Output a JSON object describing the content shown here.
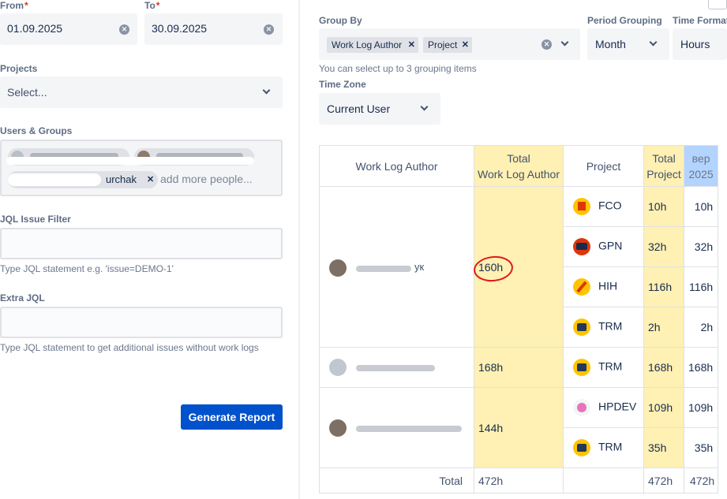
{
  "filters": {
    "from_label": "From",
    "from_value": "01.09.2025",
    "to_label": "To",
    "to_value": "30.09.2025",
    "projects_label": "Projects",
    "projects_placeholder": "Select...",
    "users_label": "Users & Groups",
    "users_chip_3_suffix": "urchak",
    "users_add_more": "add more people...",
    "jql_label": "JQL Issue Filter",
    "jql_hint": "Type JQL statement e.g. 'issue=DEMO-1'",
    "extra_jql_label": "Extra JQL",
    "extra_jql_hint": "Type JQL statement to get additional issues without work logs",
    "generate_label": "Generate Report"
  },
  "grouping": {
    "group_by_label": "Group By",
    "tags": [
      "Work Log Author",
      "Project"
    ],
    "group_hint": "You can select up to 3 grouping items",
    "period_label": "Period Grouping",
    "period_value": "Month",
    "time_format_label": "Time Format",
    "time_format_value": "Hours",
    "timezone_label": "Time Zone",
    "timezone_value": "Current User"
  },
  "table": {
    "headers": {
      "author": "Work Log Author",
      "total_author_1": "Total",
      "total_author_2": "Work Log Author",
      "project": "Project",
      "total_project_1": "Total",
      "total_project_2": "Project",
      "month_1": "вер",
      "month_2": "2025"
    },
    "groups": [
      {
        "author_suffix": "ук",
        "total": "160h",
        "rows": [
          {
            "project": "FCO",
            "total": "10h",
            "month": "10h",
            "icon_color": "#ffc400",
            "icon": "flag"
          },
          {
            "project": "GPN",
            "total": "32h",
            "month": "32h",
            "icon_color": "#de350b",
            "icon": "screen"
          },
          {
            "project": "HIH",
            "total": "116h",
            "month": "116h",
            "icon_color": "#ffc400",
            "icon": "pencil"
          },
          {
            "project": "TRM",
            "total": "2h",
            "month": "2h",
            "icon_color": "#ffc400",
            "icon": "box"
          }
        ]
      },
      {
        "author_suffix": "",
        "total": "168h",
        "rows": [
          {
            "project": "TRM",
            "total": "168h",
            "month": "168h",
            "icon_color": "#ffc400",
            "icon": "box"
          }
        ]
      },
      {
        "author_suffix": "",
        "total": "144h",
        "rows": [
          {
            "project": "HPDEV",
            "total": "109h",
            "month": "109h",
            "icon_color": "#f4f5f7",
            "icon": "flower"
          },
          {
            "project": "TRM",
            "total": "35h",
            "month": "35h",
            "icon_color": "#ffc400",
            "icon": "box"
          }
        ]
      }
    ],
    "total_label": "Total",
    "grand_total": "472h",
    "grand_project_total": "472h",
    "grand_month_total": "472h"
  },
  "colors": {
    "accent_button": "#0052cc",
    "total_column": "#fff0b3",
    "month_header": "#b3d4ff",
    "annotation_circle": "#de1b1b"
  }
}
